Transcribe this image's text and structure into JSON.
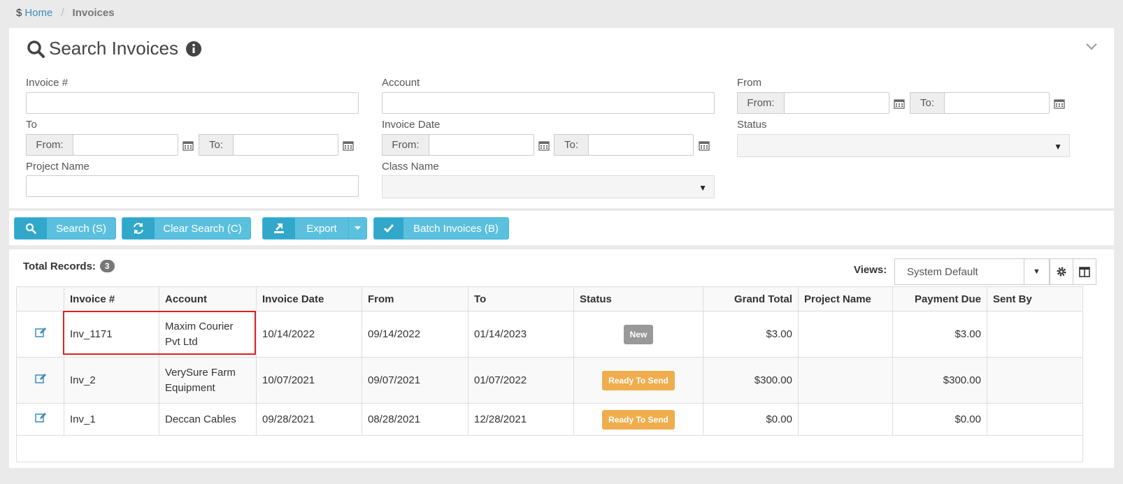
{
  "breadcrumb": {
    "home_symbol": "$",
    "home": "Home",
    "current": "Invoices"
  },
  "search": {
    "title": "Search Invoices",
    "fields": {
      "invoice_no": {
        "label": "Invoice #",
        "value": ""
      },
      "account": {
        "label": "Account",
        "value": ""
      },
      "from": {
        "label": "From",
        "from_addon": "From:",
        "to_addon": "To:",
        "from_value": "",
        "to_value": ""
      },
      "to": {
        "label": "To",
        "from_addon": "From:",
        "to_addon": "To:",
        "from_value": "",
        "to_value": ""
      },
      "invoice_date": {
        "label": "Invoice Date",
        "from_addon": "From:",
        "to_addon": "To:",
        "from_value": "",
        "to_value": ""
      },
      "status": {
        "label": "Status",
        "value": ""
      },
      "project_name": {
        "label": "Project Name",
        "value": ""
      },
      "class_name": {
        "label": "Class Name",
        "value": ""
      }
    }
  },
  "buttons": {
    "search": "Search (S)",
    "clear": "Clear Search (C)",
    "export": "Export",
    "batch": "Batch Invoices (B)"
  },
  "results": {
    "total_label": "Total Records:",
    "total_count": "3",
    "views_label": "Views:",
    "views_value": "System Default",
    "columns": [
      "",
      "Invoice #",
      "Account",
      "Invoice Date",
      "From",
      "To",
      "Status",
      "Grand Total",
      "Project Name",
      "Payment Due",
      "Sent By"
    ],
    "rows": [
      {
        "invoice": "Inv_1171",
        "account": "Maxim Courier Pvt Ltd",
        "invoice_date": "10/14/2022",
        "from": "09/14/2022",
        "to": "01/14/2023",
        "status": "New",
        "status_color": "#999999",
        "grand_total": "$3.00",
        "project_name": "",
        "payment_due": "$3.00",
        "sent_by": ""
      },
      {
        "invoice": "Inv_2",
        "account": "VerySure Farm Equipment",
        "invoice_date": "10/07/2021",
        "from": "09/07/2021",
        "to": "01/07/2022",
        "status": "Ready To Send",
        "status_color": "#f0ad4e",
        "grand_total": "$300.00",
        "project_name": "",
        "payment_due": "$300.00",
        "sent_by": ""
      },
      {
        "invoice": "Inv_1",
        "account": "Deccan Cables",
        "invoice_date": "09/28/2021",
        "from": "08/28/2021",
        "to": "12/28/2021",
        "status": "Ready To Send",
        "status_color": "#f0ad4e",
        "grand_total": "$0.00",
        "project_name": "",
        "payment_due": "$0.00",
        "sent_by": ""
      }
    ]
  },
  "colors": {
    "accent": "#5bc0de",
    "link": "#3c8dbc",
    "highlight": "#e02020"
  }
}
